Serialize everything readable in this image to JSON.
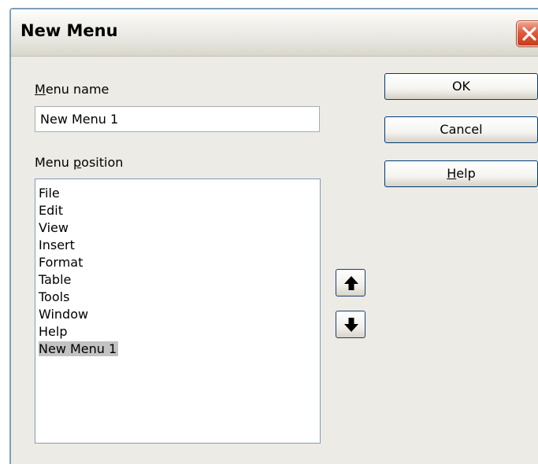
{
  "dialog": {
    "title": "New Menu"
  },
  "menu_name": {
    "label_prefix": "",
    "label_accel": "M",
    "label_rest": "enu name",
    "value": "New Menu 1"
  },
  "menu_position": {
    "label_prefix": "Menu ",
    "label_accel": "p",
    "label_rest": "osition",
    "items": [
      "File",
      "Edit",
      "View",
      "Insert",
      "Format",
      "Table",
      "Tools",
      "Window",
      "Help",
      "New Menu 1"
    ],
    "selected": "New Menu 1"
  },
  "buttons": {
    "ok": "OK",
    "cancel": "Cancel",
    "help_accel": "H",
    "help_rest": "elp"
  },
  "icons": {
    "close": "close-icon",
    "up": "arrow-up-icon",
    "down": "arrow-down-icon"
  }
}
